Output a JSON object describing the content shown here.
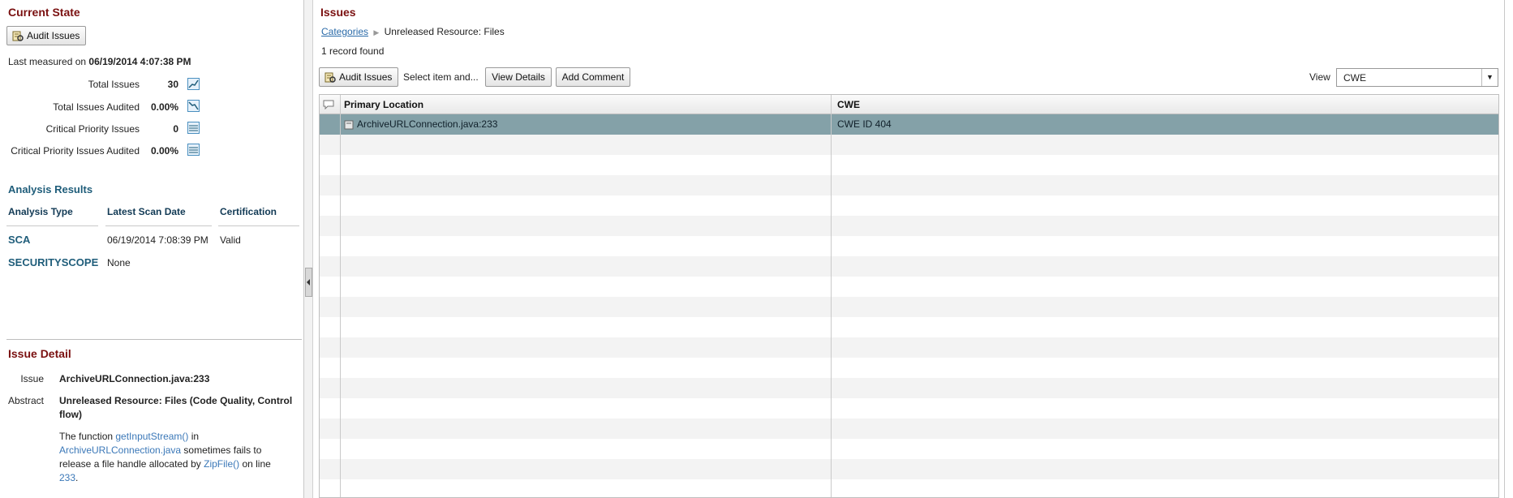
{
  "left": {
    "current_state": {
      "title": "Current State",
      "audit_button": "Audit Issues",
      "last_measured_prefix": "Last measured on",
      "last_measured_value": "06/19/2014 4:07:38 PM",
      "metrics": [
        {
          "label": "Total Issues",
          "value": "30",
          "icon": "trend-up-chart-icon"
        },
        {
          "label": "Total Issues Audited",
          "value": "0.00%",
          "icon": "trend-down-chart-icon"
        },
        {
          "label": "Critical Priority Issues",
          "value": "0",
          "icon": "flat-chart-icon"
        },
        {
          "label": "Critical Priority Issues Audited",
          "value": "0.00%",
          "icon": "flat-chart-icon"
        }
      ]
    },
    "analysis_results": {
      "title": "Analysis Results",
      "columns": [
        "Analysis Type",
        "Latest Scan Date",
        "Certification"
      ],
      "rows": [
        {
          "type": "SCA",
          "date": "06/19/2014 7:08:39 PM",
          "certification": "Valid"
        },
        {
          "type": "SECURITYSCOPE",
          "date": "None",
          "certification": ""
        }
      ]
    },
    "issue_detail": {
      "title": "Issue Detail",
      "issue_label": "Issue",
      "issue_value": "ArchiveURLConnection.java:233",
      "abstract_label": "Abstract",
      "abstract_line1": "Unreleased Resource: Files (Code Quality, Control",
      "abstract_line2": "flow)",
      "desc": {
        "l1_a": "The function ",
        "l1_link": "getInputStream()",
        "l1_b": " in",
        "l2_link": "ArchiveURLConnection.java",
        "l2_b": " sometimes fails to",
        "l3_a": "release a file handle allocated by ",
        "l3_link": "ZipFile()",
        "l3_b": " on line",
        "l4_link": "233",
        "l4_b": "."
      }
    }
  },
  "right": {
    "title": "Issues",
    "breadcrumb": {
      "link": "Categories",
      "separator": "▶",
      "current": "Unreleased Resource: Files"
    },
    "record_count": "1 record found",
    "toolbar": {
      "audit_button": "Audit Issues",
      "select_hint": "Select item and...",
      "view_details_button": "View Details",
      "add_comment_button": "Add Comment",
      "view_label": "View",
      "view_value": "CWE",
      "view_arrow": "▼"
    },
    "grid": {
      "columns": [
        "Primary Location",
        "CWE"
      ],
      "rows": [
        {
          "location": "ArchiveURLConnection.java:233",
          "cwe": "CWE ID 404"
        }
      ]
    }
  },
  "colors": {
    "section_title": "#7a1010",
    "subsection_title": "#1f5d7a",
    "selected_row": "#84a1a8",
    "link": "#3b78b8"
  }
}
